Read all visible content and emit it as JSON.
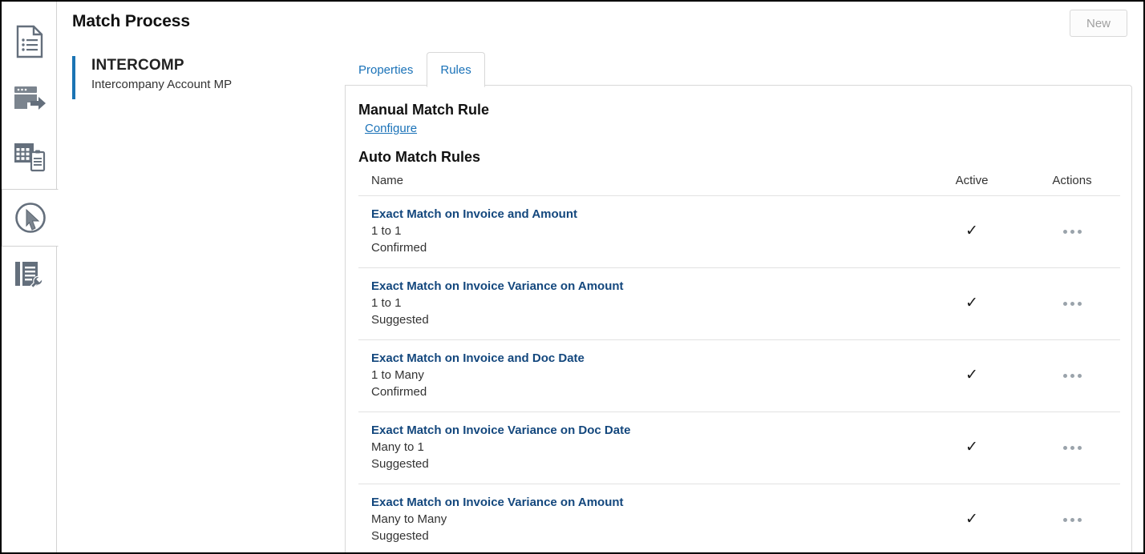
{
  "header": {
    "title": "Match Process",
    "new_button_label": "New"
  },
  "record": {
    "code": "INTERCOMP",
    "description": "Intercompany Account MP",
    "accent_color": "#1b74b4"
  },
  "sidebar": {
    "items": [
      {
        "icon": "document-list-icon",
        "name": "sidebar-item-document-list",
        "active": false
      },
      {
        "icon": "window-arrow-icon",
        "name": "sidebar-item-window-arrow",
        "active": false
      },
      {
        "icon": "grid-clipboard-icon",
        "name": "sidebar-item-grid-clipboard",
        "active": false
      },
      {
        "icon": "cursor-circle-icon",
        "name": "sidebar-item-cursor-circle",
        "active": true
      },
      {
        "icon": "document-wrench-icon",
        "name": "sidebar-item-document-wrench",
        "active": false
      }
    ]
  },
  "tabs": [
    {
      "label": "Properties",
      "active": false
    },
    {
      "label": "Rules",
      "active": true
    }
  ],
  "main": {
    "manual_section_title": "Manual Match Rule",
    "configure_link": "Configure",
    "auto_section_title": "Auto Match Rules",
    "columns": {
      "name": "Name",
      "active": "Active",
      "actions": "Actions"
    },
    "active_check_glyph": "✓",
    "rows": [
      {
        "name": "Exact Match on Invoice and Amount",
        "cardinality": "1 to 1",
        "status": "Confirmed",
        "active": true
      },
      {
        "name": "Exact Match on Invoice Variance on Amount",
        "cardinality": "1 to 1",
        "status": "Suggested",
        "active": true
      },
      {
        "name": "Exact Match on Invoice and Doc Date",
        "cardinality": "1 to Many",
        "status": "Confirmed",
        "active": true
      },
      {
        "name": "Exact Match on Invoice Variance on Doc Date",
        "cardinality": "Many to 1",
        "status": "Suggested",
        "active": true
      },
      {
        "name": "Exact Match on Invoice Variance on Amount",
        "cardinality": "Many to Many",
        "status": "Suggested",
        "active": true
      }
    ]
  },
  "colors": {
    "link": "#1a72b8",
    "rule_name": "#13477d",
    "icon_gray": "#646f7c",
    "border": "#d8d8d8"
  }
}
